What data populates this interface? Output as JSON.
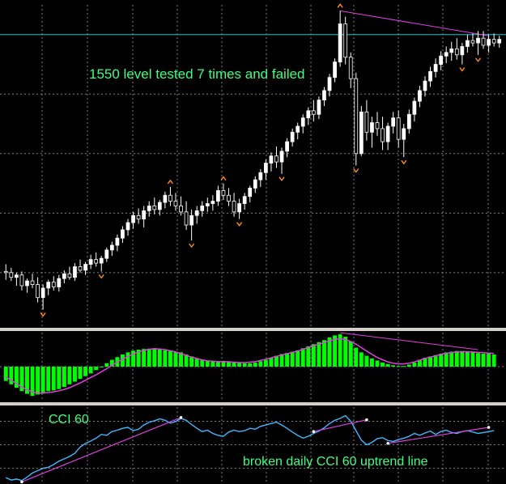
{
  "annotations": {
    "price_note": "1550 level tested 7 times and failed",
    "cci_label": "CCI 60",
    "cci_note": "broken daily CCI 60 uptrend line"
  },
  "colors": {
    "background": "#000000",
    "frame": "#d4d0c8",
    "grid": "#7f7f7f",
    "candle_bull": "#ffffff",
    "candle_bear": "#000000",
    "fractal": "#ff8c1a",
    "resistance_line": "#20c8c8",
    "trendline": "#e040e0",
    "histogram": "#00ff00",
    "signal": "#e040e0",
    "cci": "#40b8ff",
    "text": "#40ff80"
  },
  "chart_data": [
    {
      "type": "candlestick",
      "title": "",
      "xlabel": "",
      "ylabel": "",
      "ylim": [
        1060,
        1600
      ],
      "grid": true,
      "horizontal_level": 1550,
      "series": [
        {
          "name": "",
          "values": [
            [
              1152,
              1164,
              1138,
              1150
            ],
            [
              1150,
              1158,
              1136,
              1142
            ],
            [
              1142,
              1150,
              1128,
              1146
            ],
            [
              1146,
              1152,
              1120,
              1128
            ],
            [
              1128,
              1140,
              1116,
              1136
            ],
            [
              1136,
              1148,
              1124,
              1130
            ],
            [
              1130,
              1142,
              1100,
              1108
            ],
            [
              1108,
              1130,
              1088,
              1124
            ],
            [
              1124,
              1138,
              1112,
              1134
            ],
            [
              1134,
              1144,
              1120,
              1126
            ],
            [
              1126,
              1146,
              1118,
              1140
            ],
            [
              1140,
              1154,
              1132,
              1148
            ],
            [
              1148,
              1160,
              1138,
              1142
            ],
            [
              1142,
              1166,
              1136,
              1160
            ],
            [
              1160,
              1172,
              1150,
              1154
            ],
            [
              1154,
              1168,
              1146,
              1164
            ],
            [
              1164,
              1180,
              1156,
              1172
            ],
            [
              1172,
              1184,
              1160,
              1166
            ],
            [
              1166,
              1178,
              1152,
              1174
            ],
            [
              1174,
              1192,
              1168,
              1188
            ],
            [
              1188,
              1202,
              1178,
              1196
            ],
            [
              1196,
              1214,
              1186,
              1208
            ],
            [
              1208,
              1228,
              1200,
              1222
            ],
            [
              1222,
              1240,
              1212,
              1234
            ],
            [
              1234,
              1252,
              1224,
              1246
            ],
            [
              1246,
              1258,
              1232,
              1240
            ],
            [
              1240,
              1262,
              1226,
              1254
            ],
            [
              1254,
              1270,
              1244,
              1262
            ],
            [
              1262,
              1276,
              1248,
              1256
            ],
            [
              1256,
              1272,
              1246,
              1268
            ],
            [
              1268,
              1286,
              1258,
              1280
            ],
            [
              1280,
              1294,
              1262,
              1270
            ],
            [
              1270,
              1284,
              1254,
              1262
            ],
            [
              1262,
              1278,
              1246,
              1252
            ],
            [
              1252,
              1270,
              1222,
              1230
            ],
            [
              1230,
              1256,
              1204,
              1246
            ],
            [
              1246,
              1262,
              1232,
              1254
            ],
            [
              1254,
              1270,
              1244,
              1262
            ],
            [
              1262,
              1276,
              1252,
              1266
            ],
            [
              1266,
              1280,
              1254,
              1270
            ],
            [
              1270,
              1296,
              1262,
              1288
            ],
            [
              1288,
              1300,
              1272,
              1280
            ],
            [
              1280,
              1292,
              1262,
              1270
            ],
            [
              1270,
              1284,
              1244,
              1252
            ],
            [
              1252,
              1274,
              1240,
              1266
            ],
            [
              1266,
              1284,
              1256,
              1278
            ],
            [
              1278,
              1296,
              1268,
              1292
            ],
            [
              1292,
              1312,
              1284,
              1306
            ],
            [
              1306,
              1324,
              1294,
              1318
            ],
            [
              1318,
              1340,
              1306,
              1334
            ],
            [
              1334,
              1352,
              1320,
              1346
            ],
            [
              1346,
              1362,
              1326,
              1336
            ],
            [
              1336,
              1360,
              1316,
              1354
            ],
            [
              1354,
              1376,
              1344,
              1370
            ],
            [
              1370,
              1392,
              1362,
              1386
            ],
            [
              1386,
              1402,
              1374,
              1396
            ],
            [
              1396,
              1416,
              1384,
              1410
            ],
            [
              1410,
              1428,
              1398,
              1422
            ],
            [
              1422,
              1440,
              1404,
              1416
            ],
            [
              1416,
              1446,
              1408,
              1440
            ],
            [
              1440,
              1462,
              1430,
              1456
            ],
            [
              1456,
              1484,
              1446,
              1478
            ],
            [
              1478,
              1510,
              1470,
              1504
            ],
            [
              1504,
              1590,
              1496,
              1568
            ],
            [
              1568,
              1580,
              1500,
              1512
            ],
            [
              1512,
              1520,
              1460,
              1476
            ],
            [
              1476,
              1486,
              1330,
              1350
            ],
            [
              1350,
              1430,
              1346,
              1420
            ],
            [
              1420,
              1440,
              1372,
              1386
            ],
            [
              1386,
              1412,
              1360,
              1402
            ],
            [
              1402,
              1420,
              1380,
              1392
            ],
            [
              1392,
              1412,
              1356,
              1370
            ],
            [
              1370,
              1402,
              1356,
              1396
            ],
            [
              1396,
              1420,
              1384,
              1410
            ],
            [
              1410,
              1422,
              1360,
              1374
            ],
            [
              1374,
              1400,
              1344,
              1392
            ],
            [
              1392,
              1424,
              1384,
              1416
            ],
            [
              1416,
              1444,
              1404,
              1438
            ],
            [
              1438,
              1464,
              1428,
              1456
            ],
            [
              1456,
              1480,
              1446,
              1472
            ],
            [
              1472,
              1496,
              1462,
              1488
            ],
            [
              1488,
              1510,
              1478,
              1500
            ],
            [
              1500,
              1522,
              1490,
              1514
            ],
            [
              1514,
              1530,
              1502,
              1520
            ],
            [
              1520,
              1538,
              1506,
              1526
            ],
            [
              1526,
              1544,
              1508,
              1516
            ],
            [
              1516,
              1536,
              1500,
              1530
            ],
            [
              1530,
              1550,
              1520,
              1540
            ],
            [
              1540,
              1552,
              1530,
              1536
            ],
            [
              1536,
              1556,
              1516,
              1544
            ],
            [
              1544,
              1556,
              1526,
              1532
            ],
            [
              1532,
              1550,
              1520,
              1542
            ],
            [
              1542,
              1552,
              1530,
              1536
            ],
            [
              1536,
              1548,
              1528,
              1542
            ]
          ]
        }
      ]
    },
    {
      "type": "bar",
      "title": "",
      "xlabel": "",
      "ylabel": "",
      "ylim": [
        -1,
        1
      ],
      "series": [
        {
          "name": "",
          "values": [
            -0.42,
            -0.52,
            -0.62,
            -0.72,
            -0.8,
            -0.86,
            -0.82,
            -0.76,
            -0.72,
            -0.7,
            -0.66,
            -0.6,
            -0.52,
            -0.44,
            -0.36,
            -0.28,
            -0.2,
            -0.1,
            0.0,
            0.1,
            0.2,
            0.28,
            0.36,
            0.42,
            0.47,
            0.5,
            0.52,
            0.53,
            0.52,
            0.5,
            0.48,
            0.46,
            0.44,
            0.42,
            0.36,
            0.3,
            0.24,
            0.2,
            0.18,
            0.16,
            0.16,
            0.17,
            0.16,
            0.14,
            0.12,
            0.1,
            0.1,
            0.12,
            0.16,
            0.2,
            0.26,
            0.32,
            0.37,
            0.4,
            0.44,
            0.48,
            0.54,
            0.6,
            0.66,
            0.72,
            0.78,
            0.86,
            0.92,
            0.95,
            0.88,
            0.74,
            0.56,
            0.42,
            0.32,
            0.24,
            0.18,
            0.12,
            0.08,
            0.04,
            0.02,
            0.02,
            0.06,
            0.12,
            0.2,
            0.26,
            0.3,
            0.34,
            0.38,
            0.42,
            0.44,
            0.46,
            0.46,
            0.44,
            0.42,
            0.4,
            0.38,
            0.38,
            0.36
          ]
        },
        {
          "name": "",
          "values": [
            -0.3,
            -0.4,
            -0.5,
            -0.6,
            -0.68,
            -0.74,
            -0.78,
            -0.78,
            -0.76,
            -0.74,
            -0.71,
            -0.67,
            -0.62,
            -0.55,
            -0.48,
            -0.4,
            -0.32,
            -0.24,
            -0.15,
            -0.06,
            0.04,
            0.13,
            0.22,
            0.3,
            0.37,
            0.43,
            0.48,
            0.51,
            0.53,
            0.52,
            0.5,
            0.47,
            0.43,
            0.38,
            0.33,
            0.28,
            0.24,
            0.2,
            0.17,
            0.16,
            0.15,
            0.15,
            0.14,
            0.13,
            0.12,
            0.12,
            0.13,
            0.15,
            0.18,
            0.22,
            0.26,
            0.3,
            0.34,
            0.38,
            0.42,
            0.46,
            0.51,
            0.56,
            0.61,
            0.66,
            0.71,
            0.76,
            0.8,
            0.82,
            0.8,
            0.74,
            0.66,
            0.56,
            0.46,
            0.36,
            0.27,
            0.2,
            0.14,
            0.1,
            0.08,
            0.08,
            0.1,
            0.14,
            0.19,
            0.24,
            0.28,
            0.32,
            0.36,
            0.39,
            0.41,
            0.43,
            0.44,
            0.44,
            0.43,
            0.42,
            0.41,
            0.4,
            0.39
          ]
        }
      ]
    },
    {
      "type": "line",
      "title": "",
      "xlabel": "",
      "ylabel": "",
      "ylim": [
        -160,
        160
      ],
      "series": [
        {
          "name": "CCI 60",
          "values": [
            -140,
            -150,
            -146,
            -152,
            -138,
            -120,
            -110,
            -100,
            -96,
            -84,
            -70,
            -60,
            -50,
            -36,
            -10,
            6,
            16,
            28,
            44,
            40,
            56,
            62,
            70,
            74,
            60,
            66,
            84,
            96,
            102,
            110,
            104,
            92,
            98,
            112,
            104,
            86,
            70,
            56,
            62,
            48,
            40,
            36,
            54,
            62,
            56,
            60,
            70,
            66,
            78,
            84,
            90,
            96,
            84,
            70,
            54,
            40,
            28,
            36,
            48,
            58,
            72,
            90,
            104,
            112,
            124,
            100,
            60,
            20,
            0,
            10,
            26,
            30,
            18,
            14,
            22,
            28,
            36,
            48,
            40,
            50,
            58,
            44,
            56,
            62,
            52,
            48,
            56,
            60,
            54,
            48,
            52,
            56,
            60
          ]
        }
      ]
    }
  ]
}
